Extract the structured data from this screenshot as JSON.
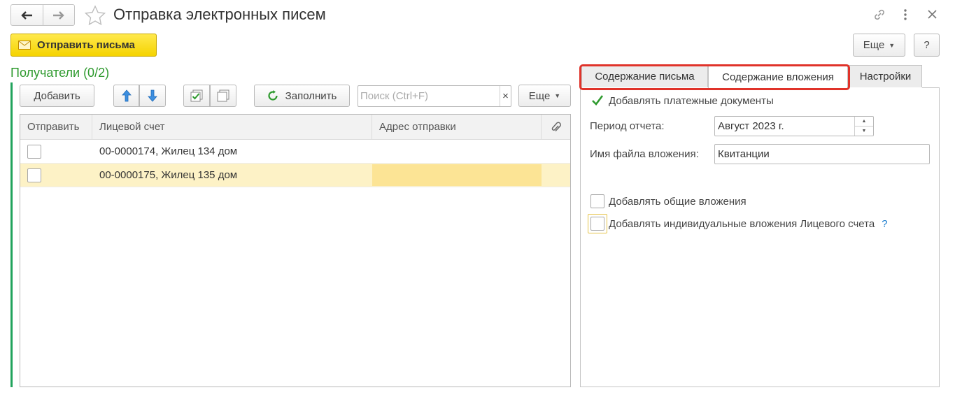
{
  "header": {
    "title": "Отправка электронных писем",
    "back_icon": "arrow-left-icon",
    "forward_icon": "arrow-right-icon",
    "favorite_icon": "star-icon"
  },
  "window_controls": {
    "link_icon": "link-icon",
    "menu_icon": "kebab-menu-icon",
    "close_icon": "close-icon"
  },
  "toolbar": {
    "send_label": "Отправить письма",
    "more_label": "Еще",
    "help_label": "?"
  },
  "recipients": {
    "title": "Получатели (0/2)",
    "add_label": "Добавить",
    "fill_label": "Заполнить",
    "search_placeholder": "Поиск (Ctrl+F)",
    "search_clear": "×",
    "more_label": "Еще",
    "columns": [
      "Отправить",
      "Лицевой счет",
      "Адрес отправки"
    ],
    "rows": [
      {
        "send": false,
        "account": "00-0000174, Жилец 134 дом",
        "address": ""
      },
      {
        "send": false,
        "account": "00-0000175, Жилец 135 дом",
        "address": ""
      }
    ],
    "selected_row": 1
  },
  "tabs": {
    "items": [
      "Содержание письма",
      "Содержание вложения",
      "Настройки"
    ],
    "active": 1
  },
  "attachment": {
    "add_payment_docs_label": "Добавлять платежные документы",
    "add_payment_docs": true,
    "period_label": "Период отчета:",
    "period_value": "Август 2023 г.",
    "filename_label": "Имя файла вложения:",
    "filename_value": "Квитанции",
    "add_common_label": "Добавлять общие вложения",
    "add_common": false,
    "add_individual_label": "Добавлять индивидуальные вложения Лицевого счета",
    "add_individual": false,
    "help_mark": "?"
  },
  "colors": {
    "accent_green": "#2e9a2e",
    "send_button_yellow": "#f5d300",
    "highlight_red": "#e0332a",
    "selected_row": "#fdf2c6"
  }
}
